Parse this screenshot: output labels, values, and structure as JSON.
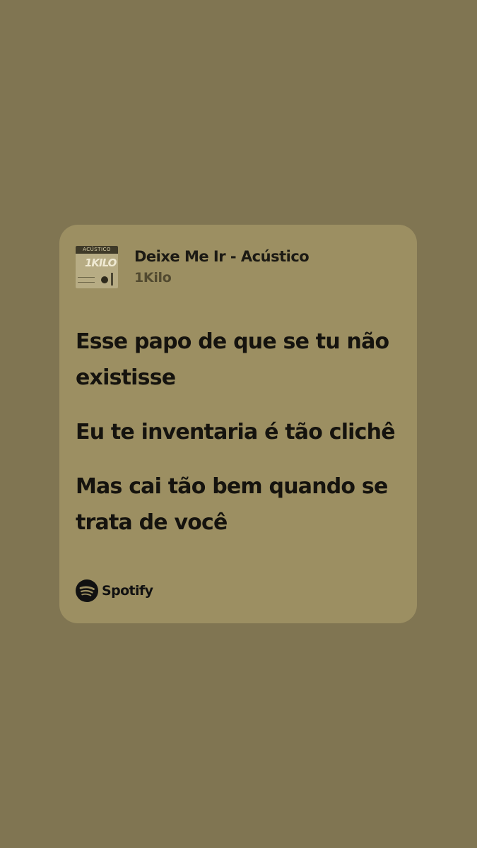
{
  "track": {
    "title": "Deixe Me Ir - Acústico",
    "artist": "1Kilo",
    "cover": {
      "tag": "ACÚSTICO",
      "logo": "1KILO"
    }
  },
  "lyrics": [
    "Esse papo de que se tu não existisse",
    "Eu te inventaria é tão clichê",
    "Mas cai tão bem quando se trata de você"
  ],
  "branding": {
    "name": "Spotify",
    "icon": "spotify-icon"
  },
  "colors": {
    "background": "#807552",
    "card": "#9c8f62",
    "text": "#15130e",
    "artist": "#524a30"
  }
}
